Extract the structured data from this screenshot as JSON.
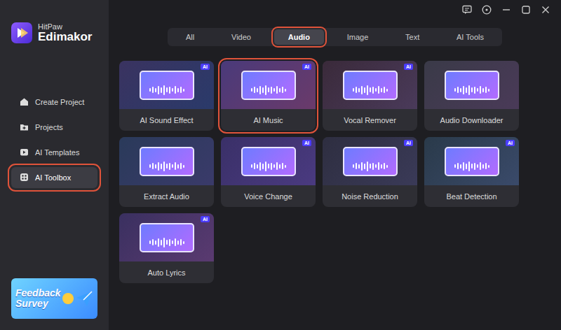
{
  "app": {
    "brand": "HitPaw",
    "product": "Edimakor"
  },
  "sidebar": {
    "items": [
      {
        "label": "Create Project",
        "selected": false,
        "highlighted": false
      },
      {
        "label": "Projects",
        "selected": false,
        "highlighted": false
      },
      {
        "label": "AI Templates",
        "selected": false,
        "highlighted": false
      },
      {
        "label": "AI Toolbox",
        "selected": true,
        "highlighted": true
      }
    ]
  },
  "banner": {
    "line1": "Feedback",
    "line2": "Survey"
  },
  "tabs": [
    {
      "label": "All",
      "selected": false,
      "highlighted": false
    },
    {
      "label": "Video",
      "selected": false,
      "highlighted": false
    },
    {
      "label": "Audio",
      "selected": true,
      "highlighted": true
    },
    {
      "label": "Image",
      "selected": false,
      "highlighted": false
    },
    {
      "label": "Text",
      "selected": false,
      "highlighted": false
    },
    {
      "label": "AI Tools",
      "selected": false,
      "highlighted": false
    }
  ],
  "ai_badge": "AI",
  "tools": [
    {
      "label": "AI Sound Effect",
      "ai": true,
      "highlighted": false
    },
    {
      "label": "AI Music",
      "ai": true,
      "highlighted": true
    },
    {
      "label": "Vocal Remover",
      "ai": true,
      "highlighted": false
    },
    {
      "label": "Audio Downloader",
      "ai": false,
      "highlighted": false
    },
    {
      "label": "Extract Audio",
      "ai": false,
      "highlighted": false
    },
    {
      "label": "Voice Change",
      "ai": true,
      "highlighted": false
    },
    {
      "label": "Noise Reduction",
      "ai": true,
      "highlighted": false
    },
    {
      "label": "Beat Detection",
      "ai": true,
      "highlighted": false
    },
    {
      "label": "Auto Lyrics",
      "ai": true,
      "highlighted": false
    }
  ]
}
